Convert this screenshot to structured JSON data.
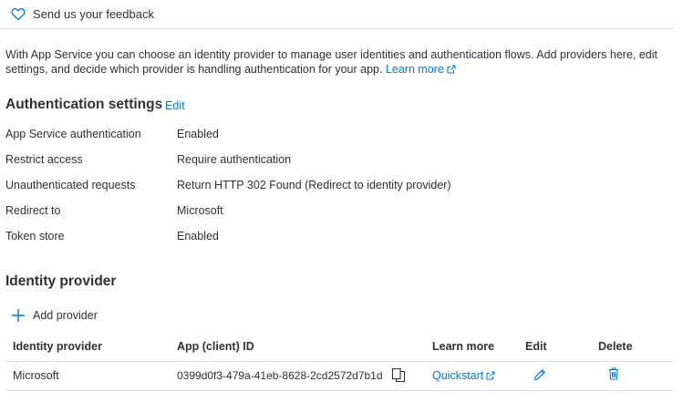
{
  "feedback": {
    "label": "Send us your feedback",
    "icon": "heart-icon"
  },
  "description": {
    "text": "With App Service you can choose an identity provider to manage user identities and authentication flows. Add providers here, edit settings, and decide which provider is handling authentication for your app. ",
    "learn_more": "Learn more"
  },
  "auth_settings": {
    "title": "Authentication settings",
    "edit_label": "Edit",
    "rows": [
      {
        "label": "App Service authentication",
        "value": "Enabled"
      },
      {
        "label": "Restrict access",
        "value": "Require authentication"
      },
      {
        "label": "Unauthenticated requests",
        "value": "Return HTTP 302 Found (Redirect to identity provider)"
      },
      {
        "label": "Redirect to",
        "value": "Microsoft"
      },
      {
        "label": "Token store",
        "value": "Enabled"
      }
    ]
  },
  "identity_provider": {
    "title": "Identity provider",
    "add_label": "Add provider",
    "table": {
      "headers": [
        "Identity provider",
        "App (client) ID",
        "Learn more",
        "Edit",
        "Delete"
      ],
      "rows": [
        {
          "provider": "Microsoft",
          "client_id": "0399d0f3-479a-41eb-8628-2cd2572d7b1d",
          "learn_more": "Quickstart"
        }
      ]
    }
  },
  "colors": {
    "accent": "#0078d4",
    "text": "#323130",
    "border": "#e1dfdd"
  }
}
